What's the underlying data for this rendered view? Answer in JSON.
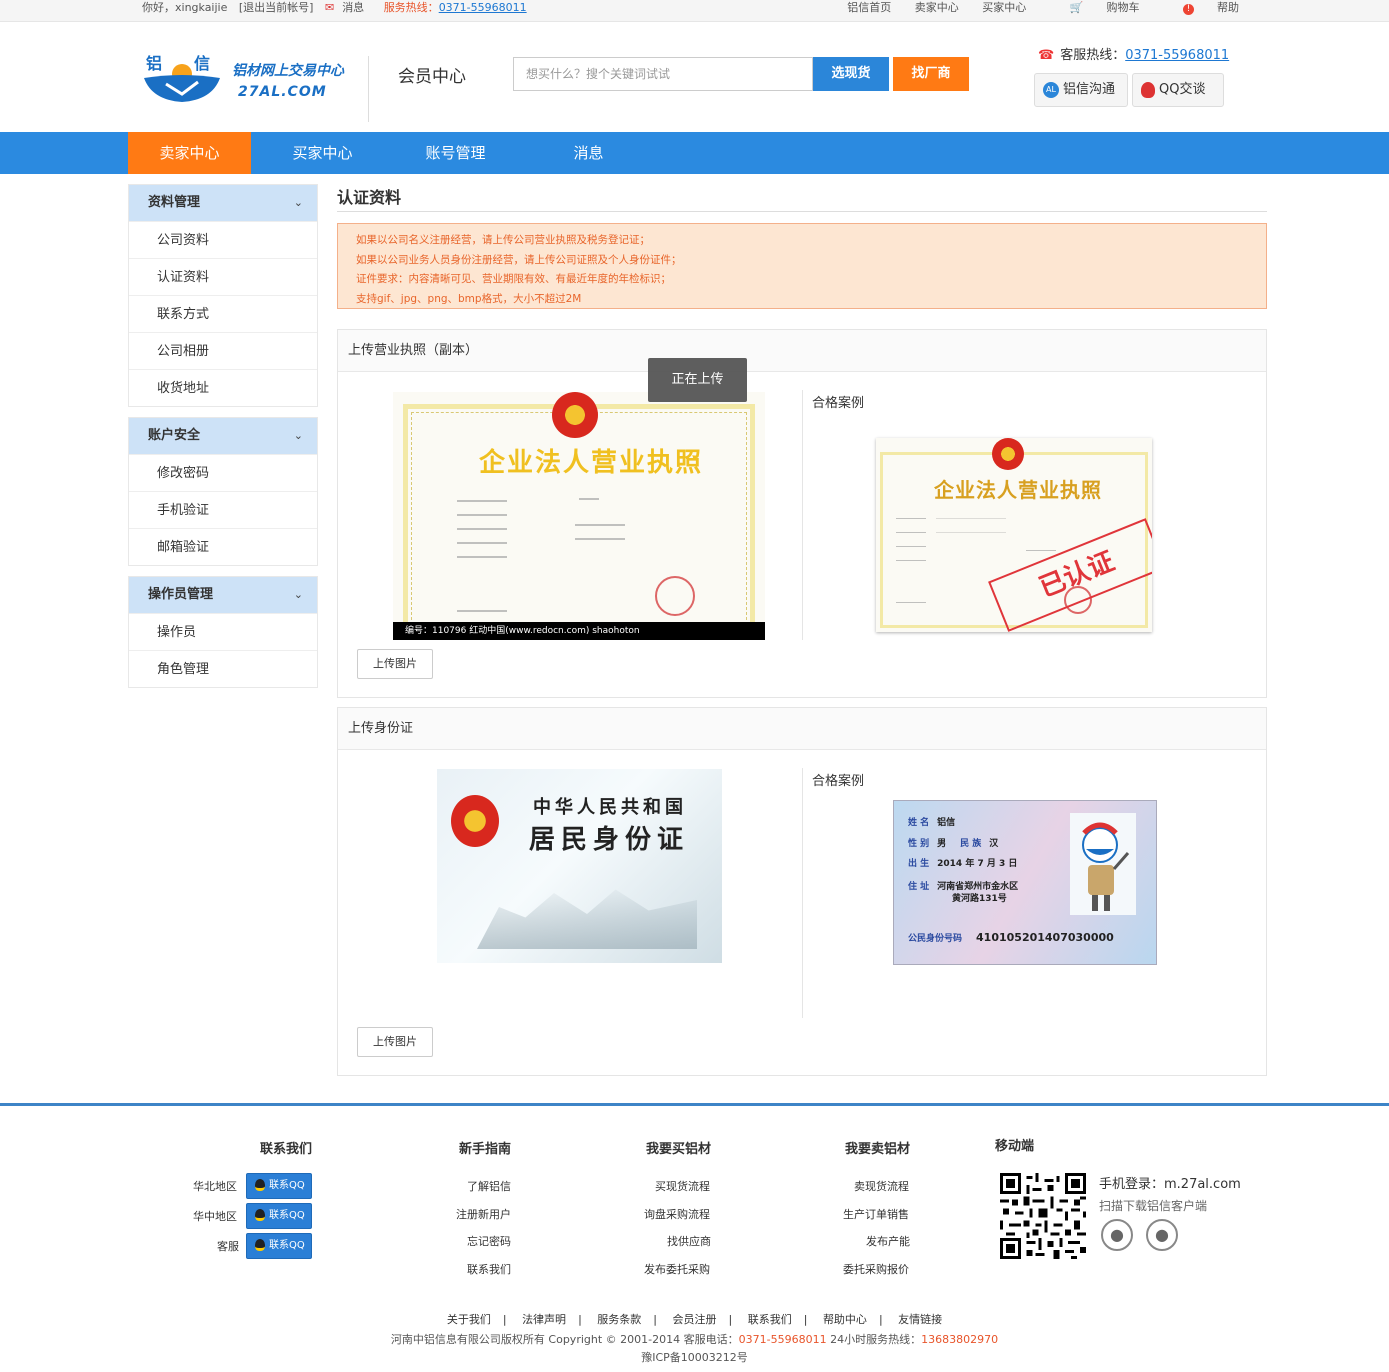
{
  "topbar": {
    "greeting": "你好，xingkaijie",
    "logout": "[退出当前帐号]",
    "messages": "消息",
    "service_label": "服务热线：",
    "service_number": "0371-55968011",
    "links": [
      "铝信首页",
      "卖家中心",
      "买家中心",
      "购物车",
      "帮助"
    ]
  },
  "header": {
    "logo_chars": [
      "铝",
      "信"
    ],
    "logo_line1": "铝材网上交易中心",
    "logo_line2": "27AL.COM",
    "section_title": "会员中心",
    "search_placeholder": "想买什么？搜个关键词试试",
    "btn_spot": "选现货",
    "btn_factory": "找厂商",
    "hotline_label": "客服热线：",
    "hotline_number": "0371-55968011",
    "btn_chat": "铝信沟通",
    "btn_qq": "QQ交谈"
  },
  "nav": [
    "卖家中心",
    "买家中心",
    "账号管理",
    "消息"
  ],
  "sidebar": [
    {
      "title": "资料管理",
      "items": [
        "公司资料",
        "认证资料",
        "联系方式",
        "公司相册",
        "收货地址"
      ]
    },
    {
      "title": "账户安全",
      "items": [
        "修改密码",
        "手机验证",
        "邮箱验证"
      ]
    },
    {
      "title": "操作员管理",
      "items": [
        "操作员",
        "角色管理"
      ]
    }
  ],
  "content": {
    "title": "认证资料",
    "notice": [
      "如果以公司名义注册经营，请上传公司营业执照及税务登记证；",
      "如果以公司业务人员身份注册经营，请上传公司证照及个人身份证件；",
      "证件要求：内容清晰可见、营业期限有效、有最近年度的年检标识；",
      "支持gif、jpg、png、bmp格式，大小不超过2M"
    ],
    "panel1": {
      "title": "上传营业执照（副本）",
      "uploading": "正在上传",
      "license_title": "企业法人营业执照",
      "image_caption": "编号：110796   红动中国(www.redocn.com) shaohoton",
      "example_label": "合格案例",
      "stamp": "已认证",
      "upload_btn": "上传图片"
    },
    "panel2": {
      "title": "上传身份证",
      "id_line1": "中华人民共和国",
      "id_line2": "居民身份证",
      "example_label": "合格案例",
      "id_back": {
        "name_label": "姓 名",
        "name": "铝信",
        "sex_label": "性 别",
        "sex": "男",
        "nation_label": "民 族",
        "nation": "汉",
        "birth_label": "出 生",
        "birth": "2014  年 7 月 3 日",
        "addr_label": "住 址",
        "addr1": "河南省郑州市金水区",
        "addr2": "黄河路131号",
        "idno_label": "公民身份号码",
        "idno": "410105201407030000"
      },
      "upload_btn": "上传图片"
    }
  },
  "footer": {
    "contact": {
      "title": "联系我们",
      "rows": [
        {
          "label": "华北地区",
          "btn": "联系QQ"
        },
        {
          "label": "华中地区",
          "btn": "联系QQ"
        },
        {
          "label": "客服",
          "btn": "联系QQ"
        }
      ]
    },
    "guide": {
      "title": "新手指南",
      "links": [
        "了解铝信",
        "注册新用户",
        "忘记密码",
        "联系我们"
      ]
    },
    "buy": {
      "title": "我要买铝材",
      "links": [
        "买现货流程",
        "询盘采购流程",
        "找供应商",
        "发布委托采购"
      ]
    },
    "sell": {
      "title": "我要卖铝材",
      "links": [
        "卖现货流程",
        "生产订单销售",
        "发布产能",
        "委托采购报价"
      ]
    },
    "mobile": {
      "title": "移动端",
      "login": "手机登录：m.27al.com",
      "download": "扫描下载铝信客户端"
    },
    "bottom_links": [
      "关于我们",
      "|",
      "法律声明",
      "|",
      "服务条款",
      "|",
      "会员注册",
      "|",
      "联系我们",
      "|",
      "帮助中心",
      "|",
      "友情链接"
    ],
    "copyright_pre": "河南中铝信息有限公司版权所有 Copyright © 2001-2014 客服电话：",
    "copyright_phone": "0371-55968011",
    "copyright_mid": " 24小时服务热线：",
    "copyright_hotline": "13683802970",
    "icp": "豫ICP备10003212号"
  },
  "colors": {
    "brand_blue": "#2b8ae0",
    "accent_orange": "#ff7a14",
    "sidebar_header": "#cde2f7",
    "notice_bg": "#fde6d2"
  }
}
